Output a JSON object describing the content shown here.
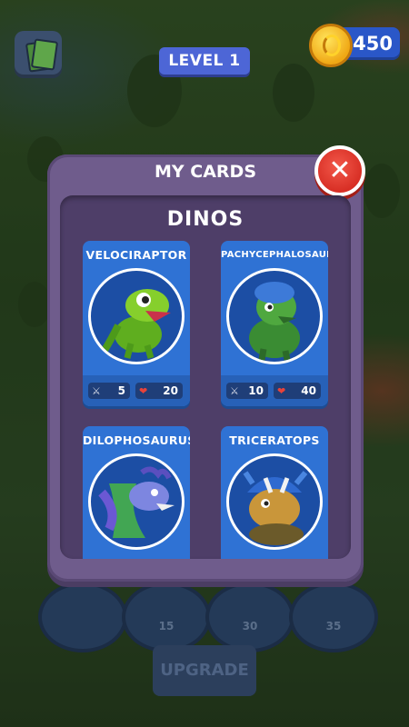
{
  "header": {
    "level_label": "LEVEL 1",
    "coins": "450",
    "cards_button_icon": "cards-icon",
    "coin_icon": "coin-icon"
  },
  "modal": {
    "title": "MY CARDS",
    "close_label": "✕",
    "section_title": "DINOS",
    "cards": [
      {
        "name": "VELOCIRAPTOR",
        "attack": "5",
        "health": "20",
        "color": "#7ac62a"
      },
      {
        "name": "PACHYCEPHALOSAURUS",
        "attack": "10",
        "health": "40",
        "color": "#3f9a3a"
      },
      {
        "name": "DILOPHOSAURUS",
        "attack": "",
        "health": "",
        "color": "#6e5bd0"
      },
      {
        "name": "TRICERATOPS",
        "attack": "",
        "health": "",
        "color": "#c79a3a"
      }
    ]
  },
  "bottom": {
    "slot_costs": [
      "15",
      "30",
      "35"
    ],
    "upgrade_label": "UPGRADE"
  },
  "colors": {
    "accent": "#4d66d6",
    "panel": "#6f5c8c",
    "card": "#2f72d4",
    "close": "#d82f25"
  }
}
